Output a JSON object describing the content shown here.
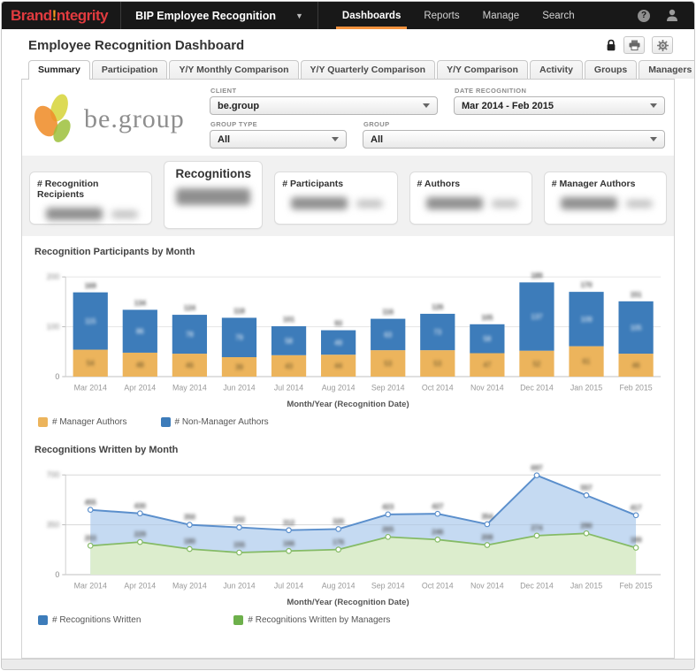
{
  "topbar": {
    "logo": {
      "brand": "Brand",
      "bang": "!",
      "rest": "ntegrity"
    },
    "app_title": "BIP Employee Recognition",
    "nav": [
      {
        "label": "Dashboards",
        "active": true
      },
      {
        "label": "Reports",
        "active": false
      },
      {
        "label": "Manage",
        "active": false
      },
      {
        "label": "Search",
        "active": false
      }
    ]
  },
  "page": {
    "title": "Employee Recognition Dashboard"
  },
  "tabs": [
    {
      "label": "Summary",
      "active": true
    },
    {
      "label": "Participation",
      "active": false
    },
    {
      "label": "Y/Y Monthly Comparison",
      "active": false
    },
    {
      "label": "Y/Y Quarterly Comparison",
      "active": false
    },
    {
      "label": "Y/Y Comparison",
      "active": false
    },
    {
      "label": "Activity",
      "active": false
    },
    {
      "label": "Groups",
      "active": false
    },
    {
      "label": "Managers",
      "active": false
    }
  ],
  "client_logo_text": "be.group",
  "filters": {
    "client": {
      "label": "CLIENT",
      "value": "be.group"
    },
    "date_recognition": {
      "label": "DATE RECOGNITION",
      "value": "Mar 2014 - Feb 2015"
    },
    "group_type": {
      "label": "GROUP TYPE",
      "value": "All"
    },
    "group": {
      "label": "GROUP",
      "value": "All"
    }
  },
  "metric_cards": [
    {
      "label": "# Recognition Recipients",
      "active": false,
      "value_blurred": true
    },
    {
      "label": "Recognitions",
      "active": true,
      "value_blurred": true
    },
    {
      "label": "# Participants",
      "active": false,
      "value_blurred": true
    },
    {
      "label": "# Authors",
      "active": false,
      "value_blurred": true
    },
    {
      "label": "# Manager Authors",
      "active": false,
      "value_blurred": true
    }
  ],
  "chart_data": [
    {
      "type": "bar",
      "stacked": true,
      "title": "Recognition Participants by Month",
      "categories": [
        "Mar 2014",
        "Apr 2014",
        "May 2014",
        "Jun 2014",
        "Jul 2014",
        "Aug 2014",
        "Sep 2014",
        "Oct 2014",
        "Nov 2014",
        "Dec 2014",
        "Jan 2015",
        "Feb 2015"
      ],
      "series": [
        {
          "name": "# Manager Authors",
          "color": "#ecb45c",
          "values": [
            54,
            48,
            46,
            39,
            43,
            44,
            53,
            53,
            47,
            52,
            61,
            46
          ]
        },
        {
          "name": "# Non-Manager Authors",
          "color": "#3d7cba",
          "values": [
            115,
            86,
            78,
            79,
            58,
            49,
            63,
            73,
            58,
            137,
            109,
            105
          ]
        }
      ],
      "totals": [
        169,
        134,
        124,
        118,
        101,
        93,
        116,
        126,
        105,
        189,
        170,
        151
      ],
      "xlabel": "Month/Year (Recognition Date)",
      "ylim": [
        0,
        200
      ],
      "yticks": [
        0,
        100,
        200
      ],
      "grid": true,
      "legend_position": "bottom-left",
      "values_blurred": true
    },
    {
      "type": "area",
      "title": "Recognitions Written by Month",
      "categories": [
        "Mar 2014",
        "Apr 2014",
        "May 2014",
        "Jun 2014",
        "Jul 2014",
        "Aug 2014",
        "Sep 2014",
        "Oct 2014",
        "Nov 2014",
        "Dec 2014",
        "Jan 2015",
        "Feb 2015"
      ],
      "series": [
        {
          "name": "# Recognitions Written",
          "line_color": "#5b8fcc",
          "fill_color": "#c5daf2",
          "legend_color": "#3d7cba",
          "values": [
            455,
            430,
            350,
            332,
            312,
            320,
            423,
            427,
            354,
            697,
            557,
            417
          ]
        },
        {
          "name": "# Recognitions Written by Managers",
          "line_color": "#85bb66",
          "fill_color": "#dcedcd",
          "legend_color": "#6db04b",
          "values": [
            203,
            229,
            180,
            155,
            166,
            176,
            265,
            246,
            208,
            274,
            290,
            189
          ]
        }
      ],
      "xlabel": "Month/Year (Recognition Date)",
      "ylim": [
        0,
        700
      ],
      "yticks": [
        0,
        350,
        700
      ],
      "grid": true,
      "legend_position": "bottom-left",
      "values_blurred": true
    }
  ]
}
